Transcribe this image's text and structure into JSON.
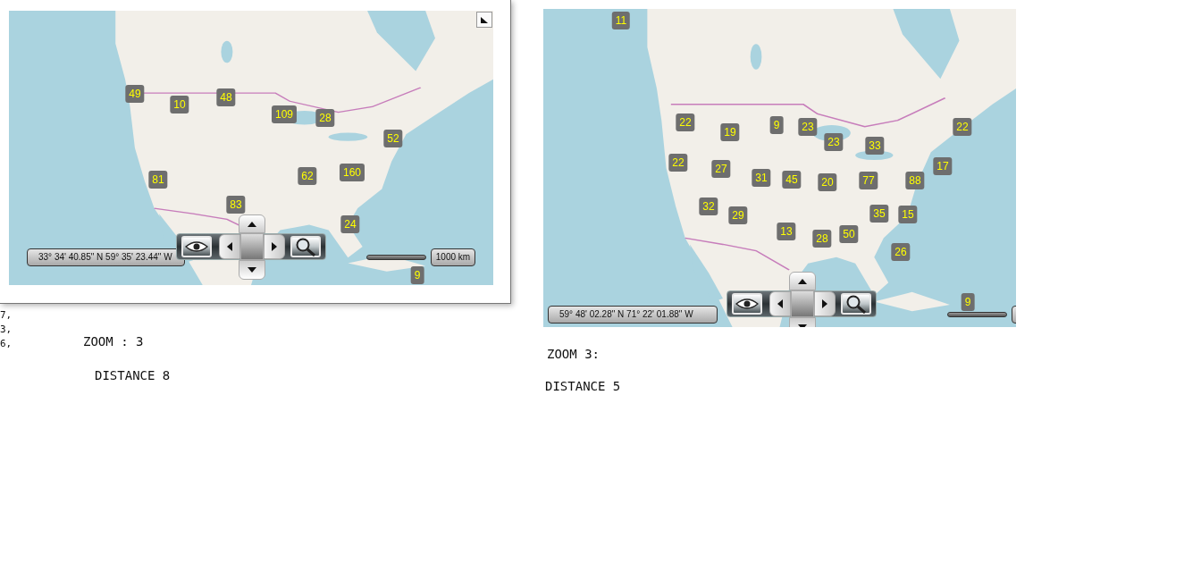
{
  "background_code": [
    "7,",
    "3,",
    "6,"
  ],
  "maps": [
    {
      "coordinates": "33° 34' 40.85\" N 59° 35' 23.44\" W",
      "scale_label": "1000 km",
      "markers": [
        "49",
        "10",
        "48",
        "109",
        "28",
        "52",
        "81",
        "62",
        "160",
        "83",
        "24",
        "9"
      ],
      "zoom_text": "ZOOM : 3",
      "distance_text": "DISTANCE 8"
    },
    {
      "coordinates": "59° 48' 02.28\" N 71° 22' 01.88\" W",
      "markers": [
        "11",
        "22",
        "19",
        "9",
        "23",
        "23",
        "33",
        "22",
        "22",
        "27",
        "31",
        "45",
        "20",
        "77",
        "88",
        "17",
        "32",
        "29",
        "35",
        "15",
        "13",
        "28",
        "50",
        "26",
        "9"
      ],
      "zoom_text": "ZOOM 3:",
      "distance_text": "DISTANCE 5"
    }
  ]
}
